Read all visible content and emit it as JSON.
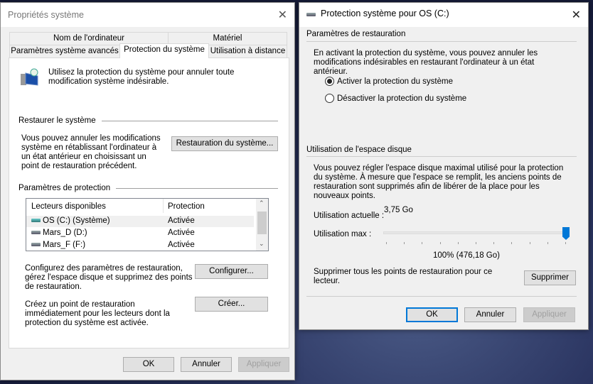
{
  "left": {
    "title": "Propriétés système",
    "tabs_row1": [
      "Nom de l'ordinateur",
      "Matériel"
    ],
    "tabs_row2": [
      "Paramètres système avancés",
      "Protection du système",
      "Utilisation à distance"
    ],
    "intro": "Utilisez la protection du système pour annuler toute modification système indésirable.",
    "restore_header": "Restaurer le système",
    "restore_text": "Vous pouvez annuler les modifications système en rétablissant l'ordinateur à un état antérieur en choisissant un point de restauration précédent.",
    "restore_button": "Restauration du système...",
    "protection_header": "Paramètres de protection",
    "table": {
      "headers": [
        "Lecteurs disponibles",
        "Protection"
      ],
      "rows": [
        [
          "OS (C:) (Système)",
          "Activée"
        ],
        [
          "Mars_D (D:)",
          "Activée"
        ],
        [
          "Mars_F (F:)",
          "Activée"
        ]
      ]
    },
    "configure_text": "Configurez des paramètres de restauration, gérez l'espace disque et supprimez des points de restauration.",
    "configure_button": "Configurer...",
    "create_text": "Créez un point de restauration immédiatement pour les lecteurs dont la protection du système est activée.",
    "create_button": "Créer...",
    "ok": "OK",
    "cancel": "Annuler",
    "apply": "Appliquer"
  },
  "right": {
    "title": "Protection système pour OS (C:)",
    "restore_header": "Paramètres de restauration",
    "restore_text": "En activant la protection du système, vous pouvez annuler les modifications indésirables en restaurant l'ordinateur à un état antérieur.",
    "radio_on": "Activer la protection du système",
    "radio_off": "Désactiver la protection du système",
    "disk_header": "Utilisation de l'espace disque",
    "disk_text": "Vous pouvez régler l'espace disque maximal utilisé pour la protection du système. À mesure que l'espace se remplit, les anciens points de restauration sont supprimés afin de libérer de la place pour les nouveaux points.",
    "current_label": "Utilisation actuelle :",
    "current_value": "3,75 Go",
    "max_label": "Utilisation max :",
    "slider_percent": 100,
    "max_value": "100% (476,18 Go)",
    "delete_text": "Supprimer tous les points de restauration pour ce lecteur.",
    "delete_button": "Supprimer",
    "ok": "OK",
    "cancel": "Annuler",
    "apply": "Appliquer",
    "accent": "#0078d7"
  }
}
